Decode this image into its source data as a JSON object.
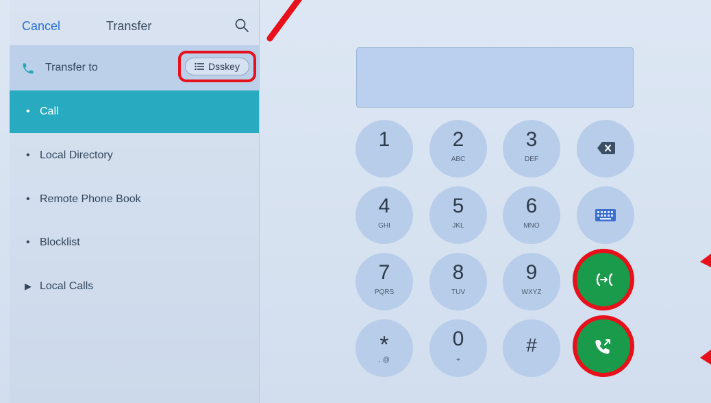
{
  "header": {
    "cancel_label": "Cancel",
    "title": "Transfer",
    "search_icon": "search-icon"
  },
  "transfer_to": {
    "label": "Transfer to",
    "icon": "phone-icon",
    "dsskey_label": "Dsskey",
    "dsskey_icon": "list-icon"
  },
  "menu": [
    {
      "label": "Call",
      "active": true
    },
    {
      "label": "Local Directory"
    },
    {
      "label": "Remote Phone Book"
    },
    {
      "label": "Blocklist"
    },
    {
      "label": "Local Calls",
      "expandable": true
    }
  ],
  "dialpad": {
    "keys": [
      {
        "digit": "1",
        "letters": ""
      },
      {
        "digit": "2",
        "letters": "ABC"
      },
      {
        "digit": "3",
        "letters": "DEF"
      },
      {
        "digit": "4",
        "letters": "GHI"
      },
      {
        "digit": "5",
        "letters": "JKL"
      },
      {
        "digit": "6",
        "letters": "MNO"
      },
      {
        "digit": "7",
        "letters": "PQRS"
      },
      {
        "digit": "8",
        "letters": "TUV"
      },
      {
        "digit": "9",
        "letters": "WXYZ"
      },
      {
        "digit": "*",
        "letters": ". @"
      },
      {
        "digit": "0",
        "letters": "+"
      },
      {
        "digit": "#",
        "letters": ""
      }
    ],
    "function_buttons": [
      "backspace-icon",
      "keyboard-icon",
      "transfer-call-icon",
      "call-icon"
    ]
  },
  "colors": {
    "accent_blue": "#2b6fd1",
    "active_row": "#28abc0",
    "call_green": "#1a9a4b",
    "annotation_red": "#e8101a"
  }
}
